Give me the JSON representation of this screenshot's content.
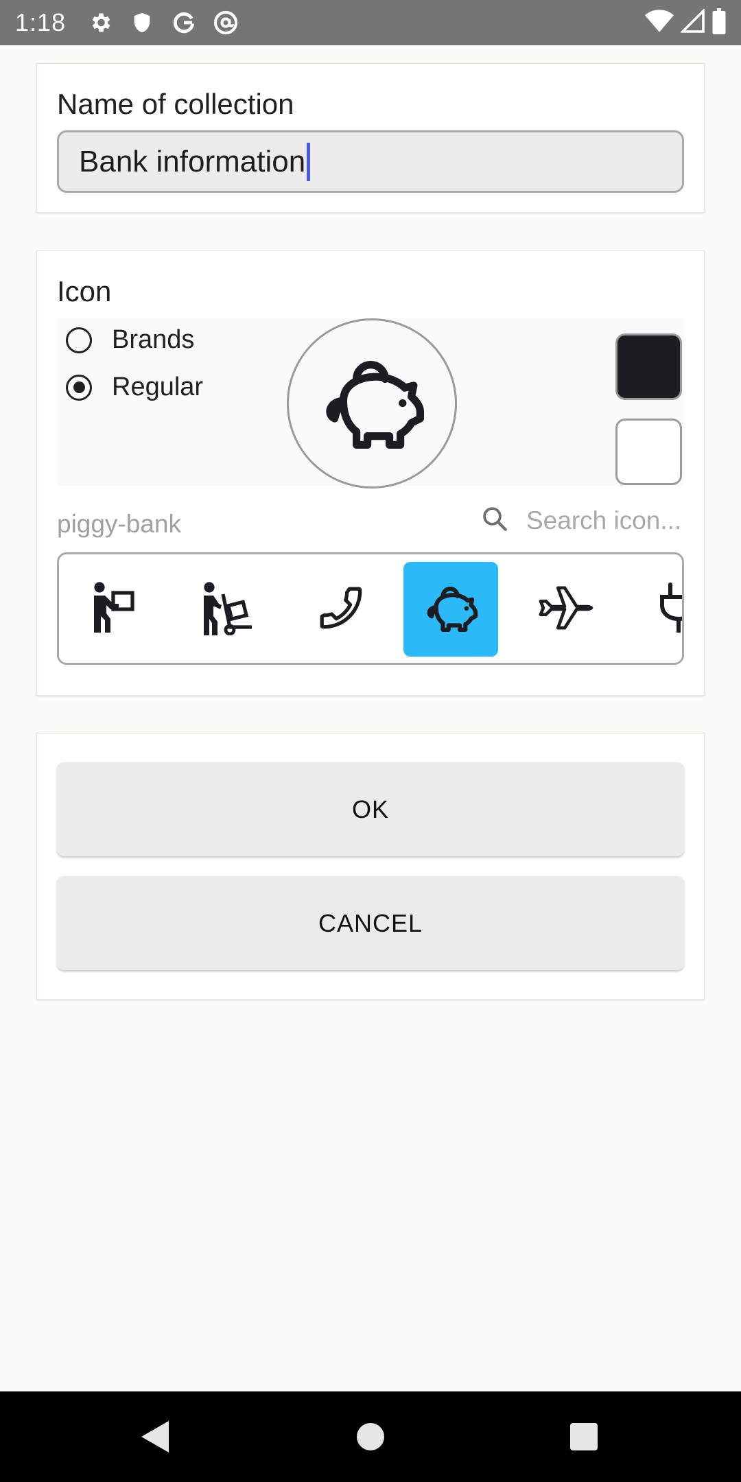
{
  "status_bar": {
    "time": "1:18",
    "left_icons": [
      "gear-icon",
      "shield-icon",
      "google-icon",
      "at-sign-icon"
    ],
    "right_icons": [
      "wifi-icon",
      "signal-icon",
      "battery-icon"
    ]
  },
  "collection": {
    "label": "Name of collection",
    "value": "Bank information"
  },
  "icon_section": {
    "label": "Icon",
    "radio_options": [
      {
        "label": "Brands",
        "selected": false
      },
      {
        "label": "Regular",
        "selected": true
      }
    ],
    "preview_icon": "piggy-bank-icon",
    "foreground_color": "#1c1c22",
    "background_color": "#ffffff",
    "selected_icon_name": "piggy-bank",
    "search_placeholder": "Search icon...",
    "icon_list": [
      {
        "name": "person-carry-box-icon",
        "selected": false
      },
      {
        "name": "person-dolly-icon",
        "selected": false
      },
      {
        "name": "phone-icon",
        "selected": false
      },
      {
        "name": "piggy-bank-icon",
        "selected": true
      },
      {
        "name": "plane-icon",
        "selected": false
      },
      {
        "name": "plug-icon",
        "selected": false
      }
    ],
    "selected_highlight_color": "#2cb9f7"
  },
  "actions": {
    "ok_label": "OK",
    "cancel_label": "CANCEL"
  }
}
